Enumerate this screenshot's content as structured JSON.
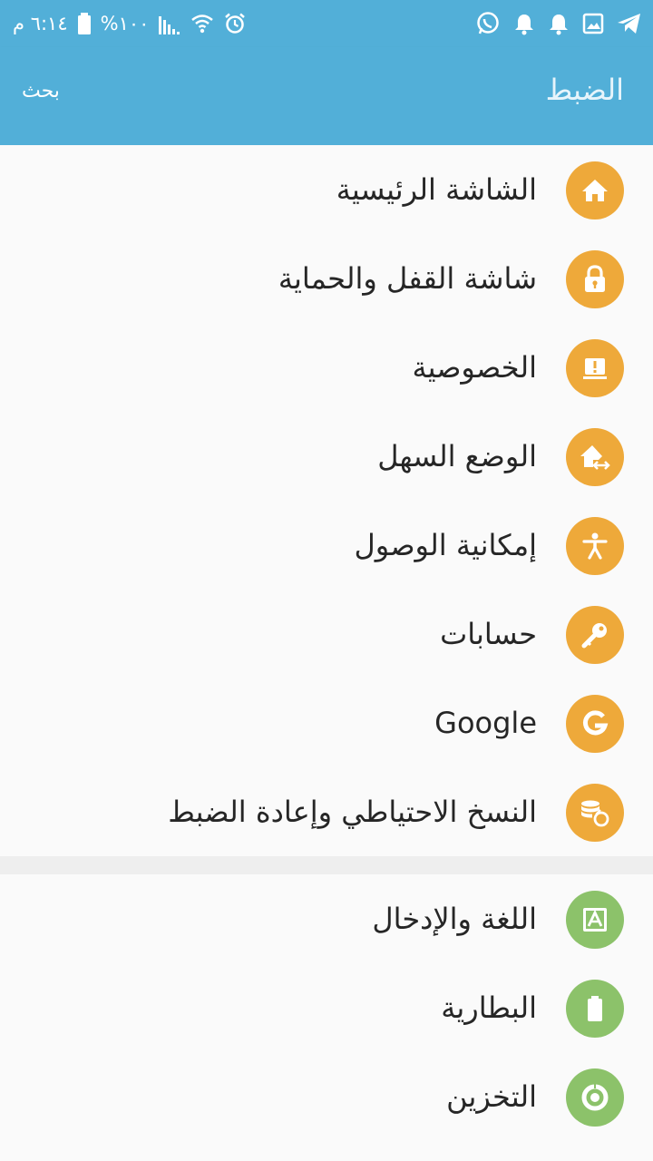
{
  "status_bar": {
    "time": "٦:١٤ م",
    "battery_level": "%١٠٠",
    "icons_right": [
      "telegram-icon",
      "gallery-icon",
      "notification-bell-icon",
      "notification-bell-icon",
      "whatsapp-icon"
    ],
    "icons_left": [
      "battery-icon",
      "signal-icon",
      "wifi-icon",
      "alarm-icon"
    ]
  },
  "app_bar": {
    "title": "الضبط",
    "search_label": "بحث"
  },
  "colors": {
    "primary": "#52afd8",
    "orange": "#eea93a",
    "green": "#8cc26a"
  },
  "sections": [
    {
      "items": [
        {
          "label": "الشاشة الرئيسية",
          "icon": "home-icon",
          "color": "#eea93a"
        },
        {
          "label": "شاشة القفل والحماية",
          "icon": "lock-icon",
          "color": "#eea93a"
        },
        {
          "label": "الخصوصية",
          "icon": "privacy-icon",
          "color": "#eea93a"
        },
        {
          "label": "الوضع السهل",
          "icon": "easy-mode-icon",
          "color": "#eea93a"
        },
        {
          "label": "إمكانية الوصول",
          "icon": "accessibility-icon",
          "color": "#eea93a"
        },
        {
          "label": "حسابات",
          "icon": "key-icon",
          "color": "#eea93a"
        },
        {
          "label": "Google",
          "icon": "google-icon",
          "color": "#eea93a"
        },
        {
          "label": "النسخ الاحتياطي وإعادة الضبط",
          "icon": "backup-icon",
          "color": "#eea93a"
        }
      ]
    },
    {
      "items": [
        {
          "label": "اللغة والإدخال",
          "icon": "language-icon",
          "color": "#8cc26a"
        },
        {
          "label": "البطارية",
          "icon": "battery-icon",
          "color": "#8cc26a"
        },
        {
          "label": "التخزين",
          "icon": "storage-icon",
          "color": "#8cc26a"
        }
      ]
    }
  ]
}
